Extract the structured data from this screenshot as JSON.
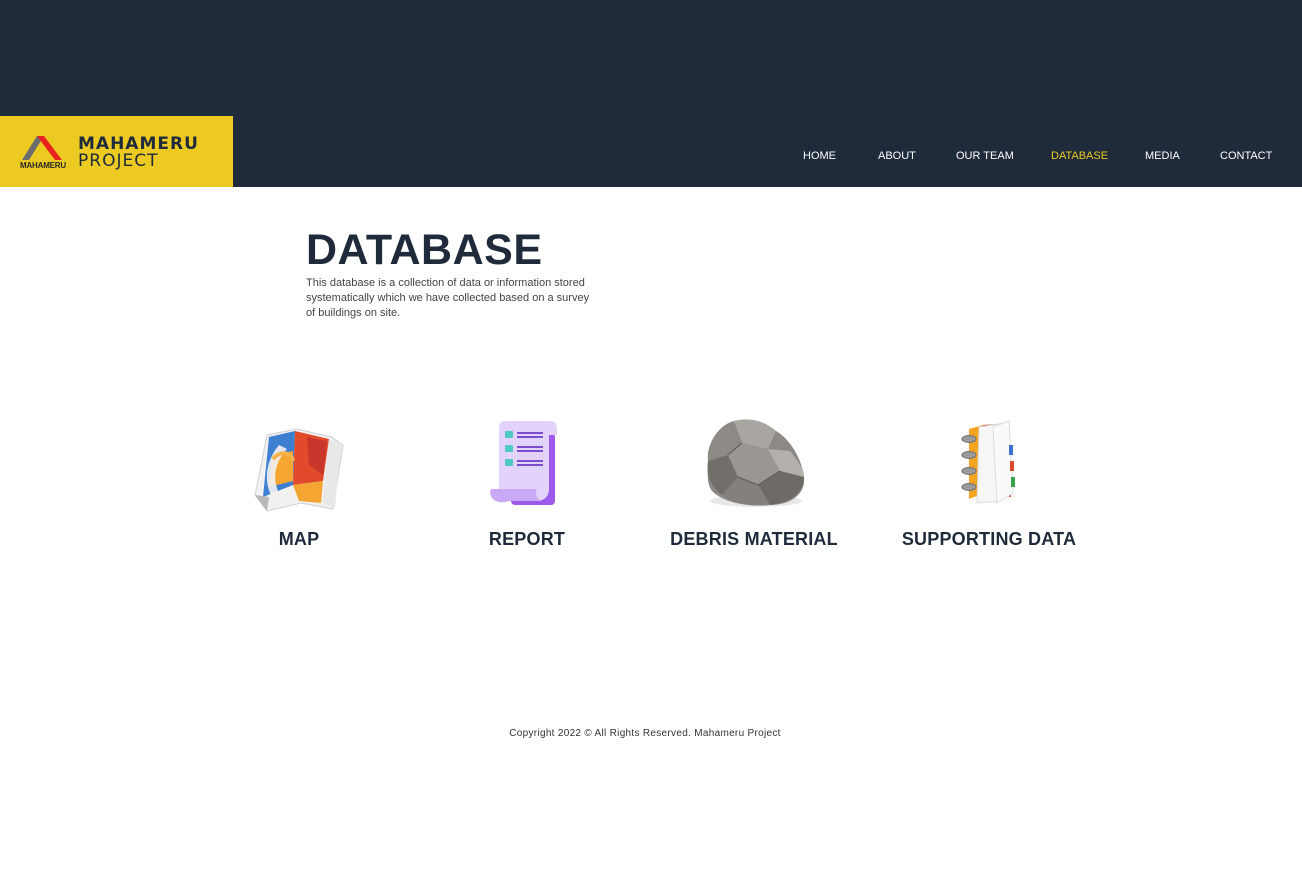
{
  "brand": {
    "mark_text": "MAHAMERU",
    "line1": "MAHAMERU",
    "line2": "PROJECT",
    "colors": {
      "header_bg": "#1f2b3b",
      "logo_bg": "#ecca22",
      "accent": "#ecca22"
    }
  },
  "nav": {
    "items": [
      {
        "label": "HOME",
        "active": false
      },
      {
        "label": "ABOUT",
        "active": false
      },
      {
        "label": "OUR TEAM",
        "active": false
      },
      {
        "label": "DATABASE",
        "active": true
      },
      {
        "label": "MEDIA",
        "active": false
      },
      {
        "label": "CONTACT",
        "active": false
      }
    ]
  },
  "main": {
    "title": "DATABASE",
    "description": "This database is a collection of data or information stored systematically which we have collected based on a survey of buildings on site."
  },
  "categories": [
    {
      "label": "MAP",
      "icon": "map-icon"
    },
    {
      "label": "REPORT",
      "icon": "report-icon"
    },
    {
      "label": "DEBRIS MATERIAL",
      "icon": "rock-icon"
    },
    {
      "label": "SUPPORTING DATA",
      "icon": "notebook-icon"
    }
  ],
  "footer": {
    "copyright": "Copyright 2022 © All Rights Reserved. Mahameru Project"
  }
}
